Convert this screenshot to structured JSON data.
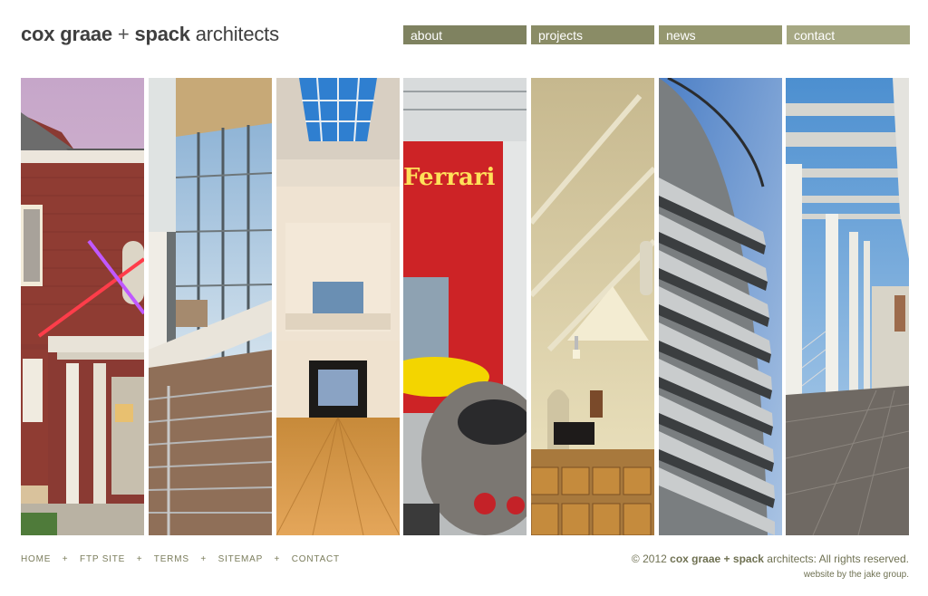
{
  "header": {
    "logo": {
      "part1": "cox graae",
      "plus": "+",
      "part2": "spack",
      "part3": "architects"
    },
    "nav": [
      {
        "label": "about"
      },
      {
        "label": "projects"
      },
      {
        "label": "news"
      },
      {
        "label": "contact"
      }
    ]
  },
  "gallery": {
    "panels": [
      {
        "name": "panel-brick-building"
      },
      {
        "name": "panel-glass-atrium"
      },
      {
        "name": "panel-skylight-hall"
      },
      {
        "name": "panel-ferrari-showroom",
        "sign_text": "Ferrari"
      },
      {
        "name": "panel-chapel-interior"
      },
      {
        "name": "panel-louvered-facade"
      },
      {
        "name": "panel-colonnade"
      }
    ]
  },
  "footer": {
    "links": [
      "HOME",
      "FTP SITE",
      "TERMS",
      "SITEMAP",
      "CONTACT"
    ],
    "separator": "+",
    "copyright": {
      "prefix": "© 2012",
      "brand1": "cox graae",
      "plus": "+",
      "brand2": "spack",
      "suffix": "architects: All rights reserved."
    },
    "credit": "website by the jake group."
  },
  "colors": {
    "nav_about": "#7f8260",
    "nav_projects": "#8a8c66",
    "nav_news": "#95976f",
    "nav_contact": "#a6a883",
    "footer_text": "#7b7d5c",
    "logo_text": "#3f3f3f"
  }
}
